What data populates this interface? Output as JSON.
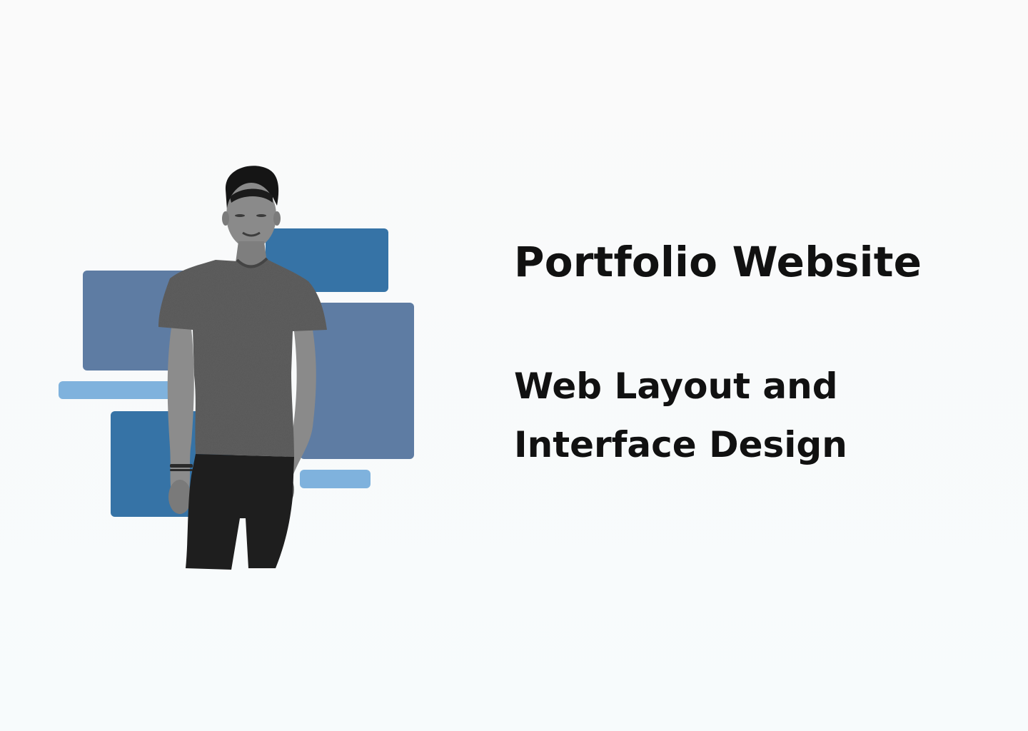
{
  "hero": {
    "title": "Portfolio Website",
    "subtitle_line1": "Web Layout and",
    "subtitle_line2": "Interface Design"
  },
  "colors": {
    "block_dark": "#3673a6",
    "block_slate": "#5e7ca3",
    "block_light": "#7fb2dd",
    "person_shirt": "#5c5c5c",
    "person_pants": "#1e1e1e",
    "text": "#111111"
  },
  "illustration": {
    "person": "grayscale-person-photo-cutout",
    "backdrop": "blue-layout-blocks"
  }
}
